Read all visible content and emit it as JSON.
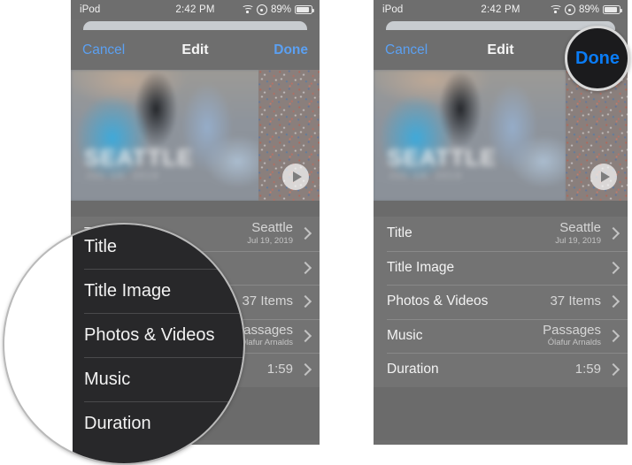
{
  "status_bar": {
    "carrier": "iPod",
    "time": "2:42 PM",
    "wifi_icon": "wifi-icon",
    "location_icon": "location-services-icon",
    "battery_percent": "89%",
    "battery_icon": "battery-icon"
  },
  "nav_bar": {
    "cancel_label": "Cancel",
    "title": "Edit",
    "done_label": "Done"
  },
  "preview": {
    "title_overlay": "SEATTLE",
    "subtitle_overlay": "JUL 19, 2019",
    "play_icon": "play-icon"
  },
  "list": {
    "rows": [
      {
        "label": "Title",
        "value": "Seattle",
        "sub": "Jul 19, 2019",
        "chevron": "chevron-right-icon"
      },
      {
        "label": "Title Image",
        "value": "",
        "sub": "",
        "chevron": "chevron-right-icon"
      },
      {
        "label": "Photos & Videos",
        "value": "37 Items",
        "sub": "",
        "chevron": "chevron-right-icon"
      },
      {
        "label": "Music",
        "value": "Passages",
        "sub": "Ólafur Arnalds",
        "chevron": "chevron-right-icon"
      },
      {
        "label": "Duration",
        "value": "1:59",
        "sub": "",
        "chevron": "chevron-right-icon"
      }
    ]
  },
  "magnifier_list": {
    "rows": [
      {
        "label": "Title"
      },
      {
        "label": "Title Image"
      },
      {
        "label": "Photos & Videos"
      },
      {
        "label": "Music"
      },
      {
        "label": "Duration"
      }
    ]
  },
  "magnifier_done": {
    "label": "Done"
  },
  "colors": {
    "accent_blue": "#5ba0f2",
    "highlight_blue": "#0a7cf5",
    "sheet_gray": "#6e6e6e",
    "list_gray": "#737373",
    "magnifier_dark": "#28282a",
    "magnifier_ring": "#b9b9b9"
  }
}
